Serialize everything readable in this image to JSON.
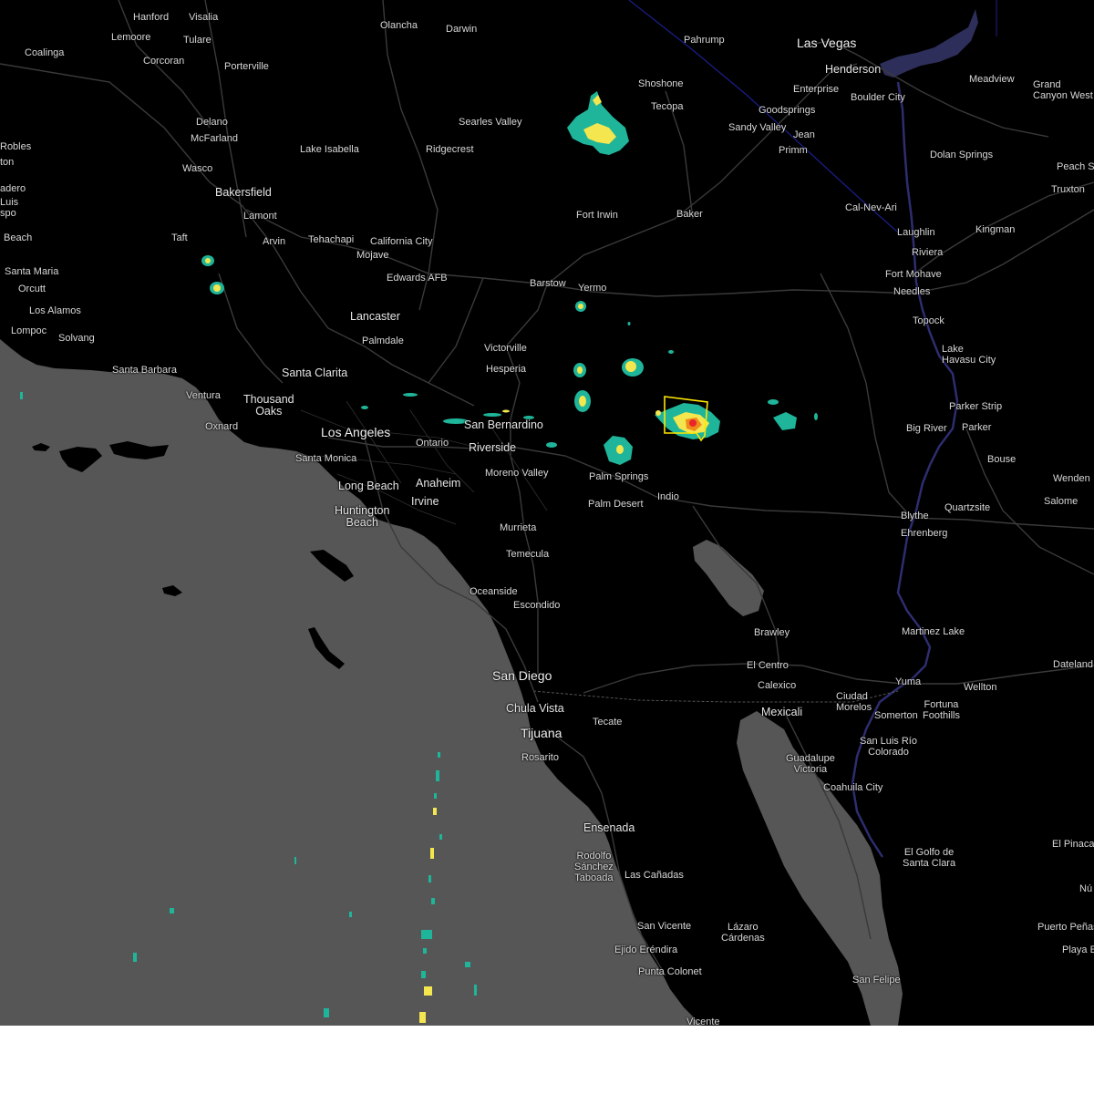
{
  "map": {
    "colors": {
      "water": "#565656",
      "land": "#000000",
      "roads": "#3a3a3a",
      "labels": "#d8d8d8",
      "border": "#1a1f8a",
      "warning_polygon": "#ffe600",
      "radar_light": "#1fb59a",
      "radar_mid": "#f3e64f",
      "radar_heavy": "#e8262a"
    },
    "places": [
      {
        "name": "Hanford",
        "size": "s"
      },
      {
        "name": "Visalia",
        "size": "s"
      },
      {
        "name": "Lemoore",
        "size": "s"
      },
      {
        "name": "Tulare",
        "size": "s"
      },
      {
        "name": "Coalinga",
        "size": "s"
      },
      {
        "name": "Corcoran",
        "size": "s"
      },
      {
        "name": "Porterville",
        "size": "s"
      },
      {
        "name": "Olancha",
        "size": "s"
      },
      {
        "name": "Darwin",
        "size": "s"
      },
      {
        "name": "Pahrump",
        "size": "s"
      },
      {
        "name": "Las Vegas",
        "size": "l"
      },
      {
        "name": "Henderson",
        "size": "m"
      },
      {
        "name": "Meadview",
        "size": "s"
      },
      {
        "name": "Grand\nCanyon West",
        "size": "s"
      },
      {
        "name": "Shoshone",
        "size": "s"
      },
      {
        "name": "Enterprise",
        "size": "s"
      },
      {
        "name": "Boulder City",
        "size": "s"
      },
      {
        "name": "Tecopa",
        "size": "s"
      },
      {
        "name": "Goodsprings",
        "size": "s"
      },
      {
        "name": "Sandy Valley",
        "size": "s"
      },
      {
        "name": "Jean",
        "size": "s"
      },
      {
        "name": "Primm",
        "size": "s"
      },
      {
        "name": "Searles Valley",
        "size": "s"
      },
      {
        "name": "Delano",
        "size": "s"
      },
      {
        "name": "McFarland",
        "size": "s"
      },
      {
        "name": "Lake Isabella",
        "size": "s"
      },
      {
        "name": "Ridgecrest",
        "size": "s"
      },
      {
        "name": "Robles",
        "size": "s"
      },
      {
        "name": "ton",
        "size": "s"
      },
      {
        "name": "Wasco",
        "size": "s"
      },
      {
        "name": "Dolan Springs",
        "size": "s"
      },
      {
        "name": "Peach S",
        "size": "s"
      },
      {
        "name": "Truxton",
        "size": "s"
      },
      {
        "name": "adero",
        "size": "s"
      },
      {
        "name": "Luis\nspo",
        "size": "s"
      },
      {
        "name": "Bakersfield",
        "size": "m"
      },
      {
        "name": "Lamont",
        "size": "s"
      },
      {
        "name": "Arvin",
        "size": "s"
      },
      {
        "name": "Fort Irwin",
        "size": "s"
      },
      {
        "name": "Baker",
        "size": "s"
      },
      {
        "name": "Cal-Nev-Ari",
        "size": "s"
      },
      {
        "name": "Laughlin",
        "size": "s"
      },
      {
        "name": "Kingman",
        "size": "s"
      },
      {
        "name": "Riviera",
        "size": "s"
      },
      {
        "name": "Beach",
        "size": "s"
      },
      {
        "name": "Taft",
        "size": "s"
      },
      {
        "name": "Tehachapi",
        "size": "s"
      },
      {
        "name": "California City",
        "size": "s"
      },
      {
        "name": "Mojave",
        "size": "s"
      },
      {
        "name": "Santa Maria",
        "size": "s"
      },
      {
        "name": "Edwards AFB",
        "size": "s"
      },
      {
        "name": "Fort Mohave",
        "size": "s"
      },
      {
        "name": "Orcutt",
        "size": "s"
      },
      {
        "name": "Barstow",
        "size": "s"
      },
      {
        "name": "Yermo",
        "size": "s"
      },
      {
        "name": "Needles",
        "size": "s"
      },
      {
        "name": "Los Alamos",
        "size": "s"
      },
      {
        "name": "Lancaster",
        "size": "m"
      },
      {
        "name": "Topock",
        "size": "s"
      },
      {
        "name": "Lompoc",
        "size": "s"
      },
      {
        "name": "Solvang",
        "size": "s"
      },
      {
        "name": "Palmdale",
        "size": "s"
      },
      {
        "name": "Victorville",
        "size": "s"
      },
      {
        "name": "Lake\nHavasu City",
        "size": "s"
      },
      {
        "name": "Hesperia",
        "size": "s"
      },
      {
        "name": "Santa Barbara",
        "size": "s"
      },
      {
        "name": "Santa Clarita",
        "size": "m"
      },
      {
        "name": "Ventura",
        "size": "s"
      },
      {
        "name": "Thousand\nOaks",
        "size": "m"
      },
      {
        "name": "Parker Strip",
        "size": "s"
      },
      {
        "name": "San Bernardino",
        "size": "m"
      },
      {
        "name": "Oxnard",
        "size": "s"
      },
      {
        "name": "Big River",
        "size": "s"
      },
      {
        "name": "Parker",
        "size": "s"
      },
      {
        "name": "Los Angeles",
        "size": "l"
      },
      {
        "name": "Ontario",
        "size": "s"
      },
      {
        "name": "Riverside",
        "size": "m"
      },
      {
        "name": "Santa Monica",
        "size": "s"
      },
      {
        "name": "Bouse",
        "size": "s"
      },
      {
        "name": "Moreno Valley",
        "size": "s"
      },
      {
        "name": "Palm Springs",
        "size": "s"
      },
      {
        "name": "Wenden",
        "size": "s"
      },
      {
        "name": "Anaheim",
        "size": "m"
      },
      {
        "name": "Long Beach",
        "size": "m"
      },
      {
        "name": "Indio",
        "size": "s"
      },
      {
        "name": "Palm Desert",
        "size": "s"
      },
      {
        "name": "Salome",
        "size": "s"
      },
      {
        "name": "Irvine",
        "size": "m"
      },
      {
        "name": "Quartzsite",
        "size": "s"
      },
      {
        "name": "Huntington\nBeach",
        "size": "m"
      },
      {
        "name": "Blythe",
        "size": "s"
      },
      {
        "name": "Murrieta",
        "size": "s"
      },
      {
        "name": "Ehrenberg",
        "size": "s"
      },
      {
        "name": "Temecula",
        "size": "s"
      },
      {
        "name": "Oceanside",
        "size": "s"
      },
      {
        "name": "Escondido",
        "size": "s"
      },
      {
        "name": "Brawley",
        "size": "s"
      },
      {
        "name": "Martinez Lake",
        "size": "s"
      },
      {
        "name": "El Centro",
        "size": "s"
      },
      {
        "name": "Dateland",
        "size": "s"
      },
      {
        "name": "San Diego",
        "size": "l"
      },
      {
        "name": "Yuma",
        "size": "s"
      },
      {
        "name": "Calexico",
        "size": "s"
      },
      {
        "name": "Wellton",
        "size": "s"
      },
      {
        "name": "Ciudad\nMorelos",
        "size": "s"
      },
      {
        "name": "Chula Vista",
        "size": "m"
      },
      {
        "name": "Fortuna\nFoothills",
        "size": "s"
      },
      {
        "name": "Mexicali",
        "size": "m"
      },
      {
        "name": "Somerton",
        "size": "s"
      },
      {
        "name": "Tecate",
        "size": "s"
      },
      {
        "name": "Tijuana",
        "size": "l"
      },
      {
        "name": "San Luis Río\nColorado",
        "size": "s"
      },
      {
        "name": "Rosarito",
        "size": "s"
      },
      {
        "name": "Guadalupe\nVictoria",
        "size": "s"
      },
      {
        "name": "Coahuila City",
        "size": "s"
      },
      {
        "name": "Ensenada",
        "size": "m"
      },
      {
        "name": "El Pinaca",
        "size": "s"
      },
      {
        "name": "Rodolfo\nSánchez\nTaboada",
        "size": "s"
      },
      {
        "name": "Las Cañadas",
        "size": "s"
      },
      {
        "name": "El Golfo de\nSanta Clara",
        "size": "s"
      },
      {
        "name": "Nú",
        "size": "s"
      },
      {
        "name": "San Vicente",
        "size": "s"
      },
      {
        "name": "Lázaro\nCárdenas",
        "size": "s"
      },
      {
        "name": "Puerto Peñas",
        "size": "s"
      },
      {
        "name": "Ejido Eréndira",
        "size": "s"
      },
      {
        "name": "Playa E",
        "size": "s"
      },
      {
        "name": "Punta Colonet",
        "size": "s"
      },
      {
        "name": "San Felipe",
        "size": "s"
      },
      {
        "name": "Vicente",
        "size": "s"
      }
    ]
  }
}
